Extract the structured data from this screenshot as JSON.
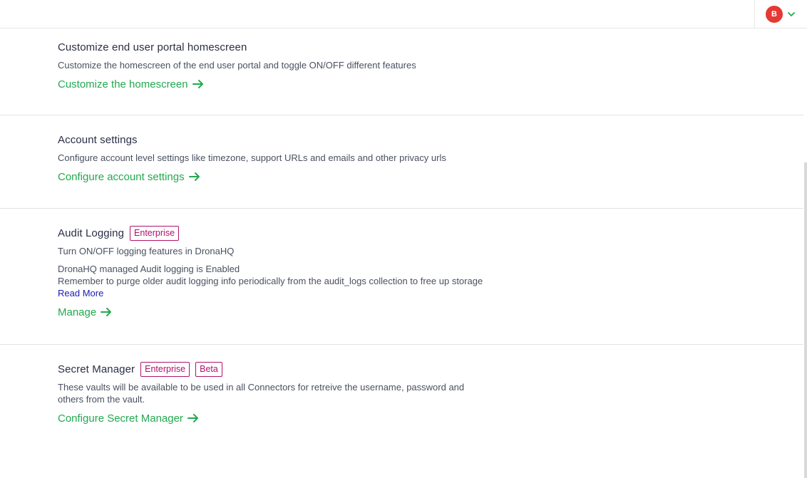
{
  "header": {
    "user_initial": "B"
  },
  "sections": [
    {
      "title": "Customize end user portal homescreen",
      "description": "Customize the homescreen of the end user portal and toggle ON/OFF different features",
      "action": "Customize the homescreen"
    },
    {
      "title": "Account settings",
      "description": "Configure account level settings like timezone, support URLs and emails and other privacy urls",
      "action": "Configure account settings"
    },
    {
      "title": "Audit Logging",
      "badges": [
        "Enterprise"
      ],
      "description": "Turn ON/OFF logging features in DronaHQ",
      "status_line": "DronaHQ managed Audit logging is Enabled",
      "note": "Remember to purge older audit logging info periodically from the audit_logs collection to free up storage",
      "read_more": "Read More",
      "action": "Manage"
    },
    {
      "title": "Secret Manager",
      "badges": [
        "Enterprise",
        "Beta"
      ],
      "description": "These vaults will be available to be used in all Connectors for retreive the username, password and others from the vault.",
      "action": "Configure Secret Manager"
    }
  ],
  "colors": {
    "accent": "#23a94f",
    "badge": "#b0126b",
    "link": "#1a1ab5",
    "avatar": "#e53935"
  }
}
